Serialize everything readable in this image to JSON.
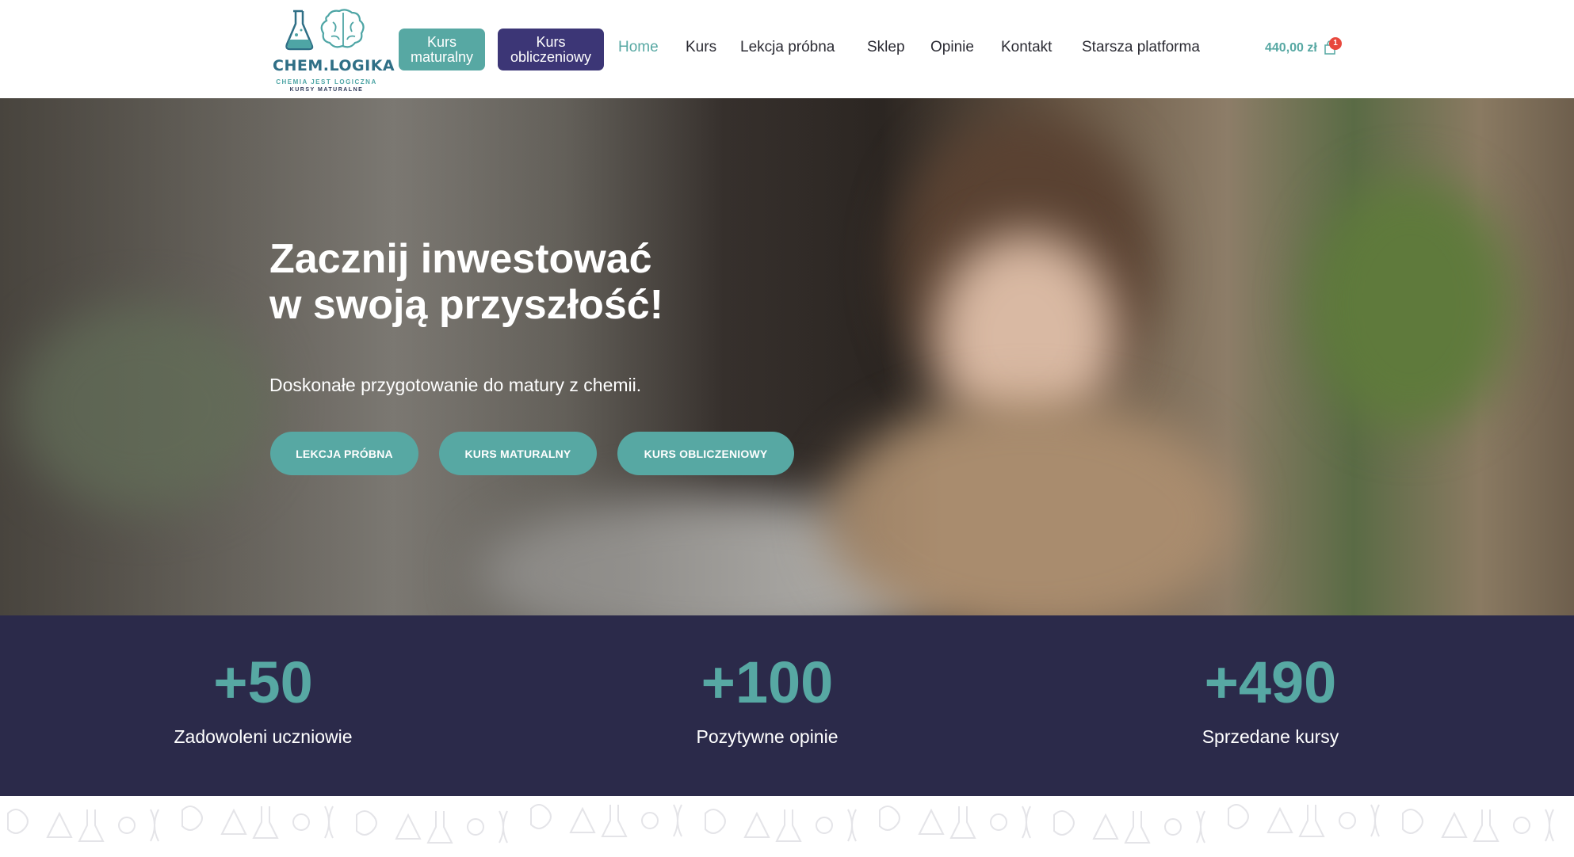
{
  "header": {
    "logo": {
      "title": "CHEM.LOGIKA",
      "tagline": "CHEMIA JEST LOGICZNA",
      "subtagline": "KURSY MATURALNE"
    },
    "pill_buttons": [
      {
        "line1": "Kurs",
        "line2": "maturalny"
      },
      {
        "line1": "Kurs",
        "line2": "obliczeniowy"
      }
    ],
    "nav": [
      "Home",
      "Kurs",
      "Lekcja próbna",
      "Sklep",
      "Opinie",
      "Kontakt",
      "Starsza platforma"
    ],
    "active_nav": "Home",
    "cart": {
      "amount": "440,00 zł",
      "count": "1"
    }
  },
  "hero": {
    "title_line1": "Zacznij inwestować",
    "title_line2": "w swoją przyszłość!",
    "subtitle": "Doskonałe przygotowanie do matury z chemii.",
    "buttons": [
      "LEKCJA PRÓBNA",
      "KURS MATURALNY",
      "KURS OBLICZENIOWY"
    ]
  },
  "stats": [
    {
      "value": "+50",
      "label": "Zadowoleni uczniowie"
    },
    {
      "value": "+100",
      "label": "Pozytywne opinie"
    },
    {
      "value": "+490",
      "label": "Sprzedane kursy"
    }
  ],
  "colors": {
    "teal": "#57a8a3",
    "purple": "#3c3676",
    "stats_bg": "#2b2a4a",
    "cart_badge": "#e8483d"
  }
}
